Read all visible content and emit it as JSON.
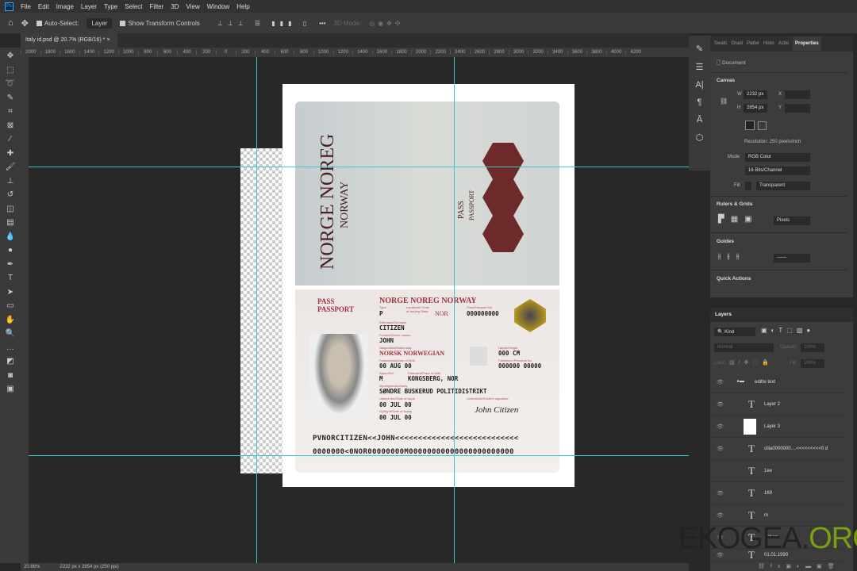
{
  "menu": [
    "File",
    "Edit",
    "Image",
    "Layer",
    "Type",
    "Select",
    "Filter",
    "3D",
    "View",
    "Window",
    "Help"
  ],
  "options": {
    "auto_select": "Auto-Select:",
    "auto_select_target": "Layer",
    "show_transform": "Show Transform Controls",
    "more": "•••",
    "mode_3d": "3D Mode:"
  },
  "doc_tab": "Italy id.psd @ 20.7% (RGB/16) *",
  "ruler": [
    "2000",
    "1800",
    "1600",
    "1400",
    "1200",
    "1000",
    "800",
    "600",
    "400",
    "200",
    "0",
    "200",
    "400",
    "600",
    "800",
    "1000",
    "1200",
    "1400",
    "1600",
    "1800",
    "2000",
    "2200",
    "2400",
    "2600",
    "2800",
    "3000",
    "3200",
    "3400",
    "3600",
    "3800",
    "4000",
    "4200"
  ],
  "passport": {
    "cover_title": "NORGE NOREG",
    "cover_sub": "NORWAY",
    "cover_pass": "PASS",
    "cover_passport": "PASSPORT",
    "pass": "PASS",
    "passport": "PASSPORT",
    "country": "NORGE NOREG NORWAY",
    "labels": {
      "type": "Type",
      "code": "Landkode/ Code of Issuing State",
      "passno": "Pass/Passport No.",
      "surname": "Etternavn/Surname",
      "given": "Fornavn/Given names",
      "nationality": "Nasjonalitet/Nationality",
      "height": "Høyde/Height",
      "dob": "Fødselsdato/Date of birth",
      "personal": "Fødselsnr./Personal No.",
      "sex": "Kjønn/Sex",
      "pob": "Fødested/Place of birth",
      "authority": "Myndighet/Authority",
      "issue": "Utstedt den/Date of issue",
      "signature": "Underskrift/Holder's signature",
      "expiry": "Gyldig til/Date of expiry"
    },
    "type": "P",
    "code": "NOR",
    "passno": "000000000",
    "surname": "CITIZEN",
    "given": "JOHN",
    "nationality": "NORSK NORWEGIAN",
    "height": "000 CM",
    "dob": "00 AUG 00",
    "personal": "000000 00000",
    "sex": "M",
    "pob": "KONGSBERG, NOR",
    "authority": "SØNDRE BUSKERUD POLITIDISTRIKT",
    "issue": "00 JUL 00",
    "expiry": "00 JUL 00",
    "signature": "John Citizen",
    "mrz1": "PVNORCITIZEN<<JOHN<<<<<<<<<<<<<<<<<<<<<<<<<<<",
    "mrz2": "0000000<0NOR00000000M00000000000000000000000"
  },
  "properties": {
    "tabs": [
      "Swatc",
      "Gradi",
      "Patter",
      "Histo",
      "Actio",
      "Properties"
    ],
    "document": "Document",
    "canvas": "Canvas",
    "w_label": "W",
    "w": "2232 px",
    "h_label": "H",
    "h": "2854 px",
    "x_label": "X",
    "y_label": "Y",
    "resolution": "Resolution: 250 pixels/inch",
    "mode_label": "Mode",
    "mode": "RGB Color",
    "depth": "16 Bits/Channel",
    "fill_label": "Fill",
    "fill": "Transparent",
    "rulers": "Rulers & Grids",
    "units": "Pixels",
    "guides": "Guides",
    "quick": "Quick Actions"
  },
  "layers": {
    "title": "Layers",
    "kind": "Kind",
    "blend": "Normal",
    "opacity_label": "Opacity:",
    "opacity": "100%",
    "lock_label": "Lock:",
    "fill_label": "Fill:",
    "fill": "100%",
    "group": "editte text",
    "items": [
      "Layer 2",
      "Layer 3",
      "cilia0000000....<<<<<<<<<0 d",
      "1ee",
      "169",
      "m",
      "126cm",
      "01.01.1990"
    ]
  },
  "status": {
    "zoom": "20.66%",
    "size": "2232 px x 2854 px (250 ppi)"
  },
  "watermark": {
    "a": "EKOGEA.",
    "b": "ORG"
  }
}
